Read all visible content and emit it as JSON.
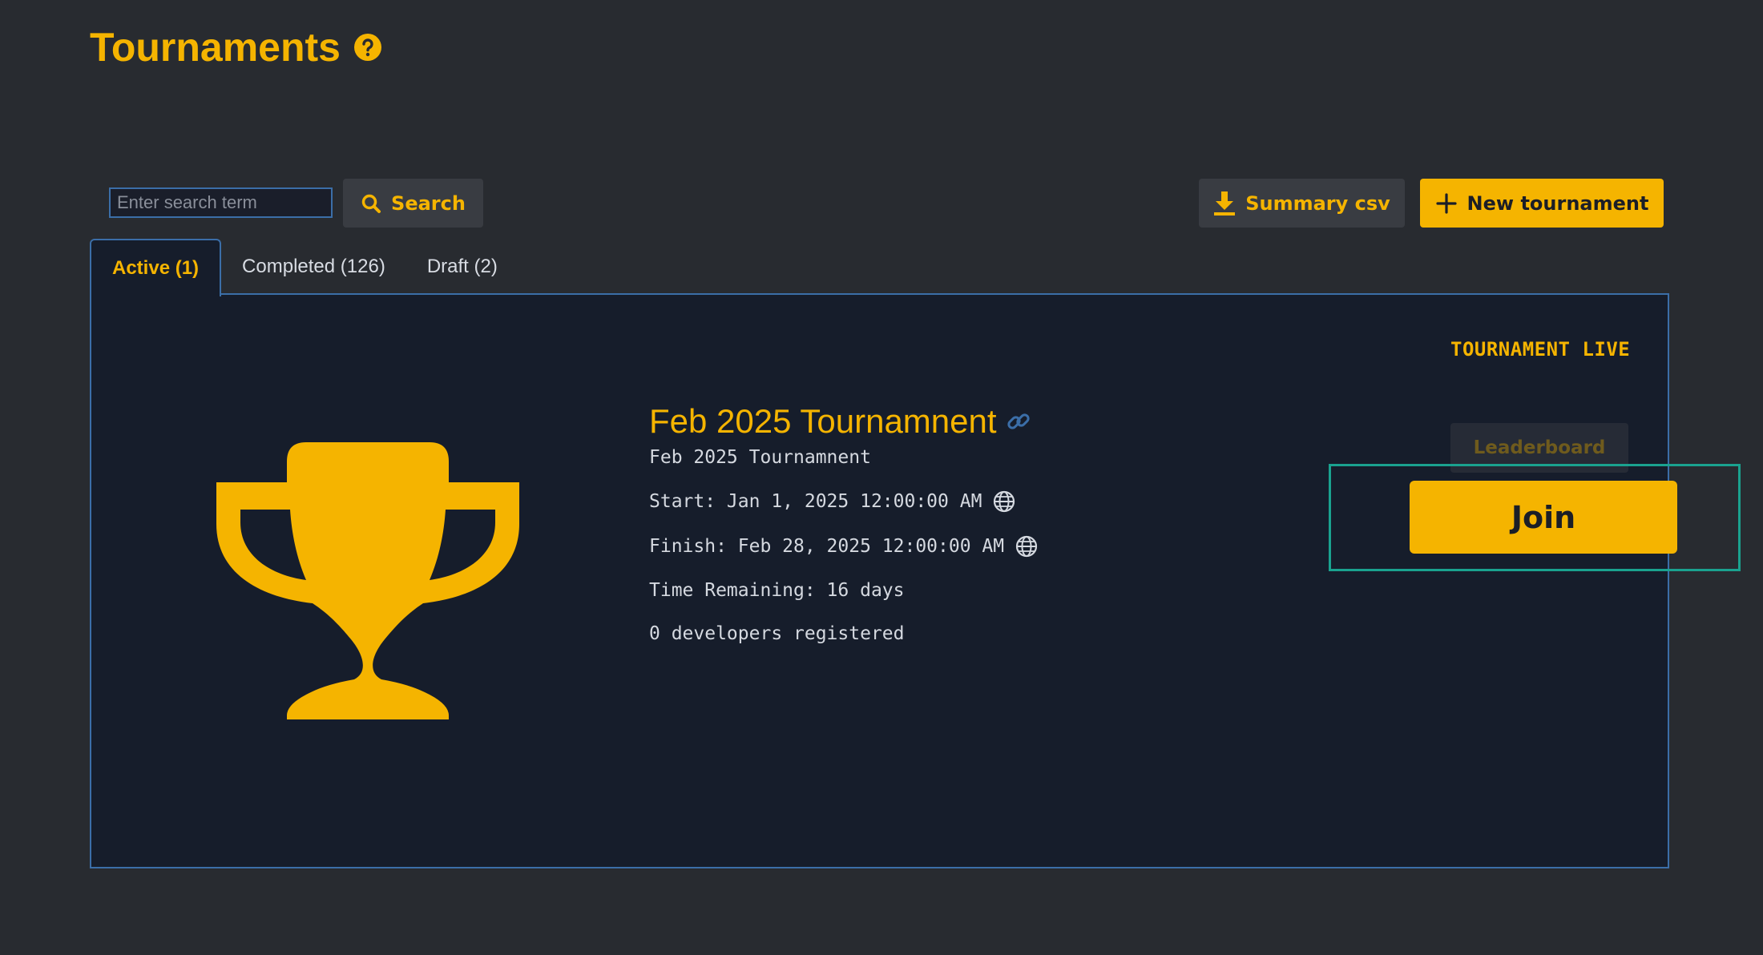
{
  "header": {
    "title": "Tournaments",
    "help_icon": "question-circle-icon"
  },
  "search": {
    "placeholder": "Enter search term",
    "value": "",
    "button_label": "Search",
    "button_icon": "search-icon"
  },
  "actions": {
    "summary_csv_label": "Summary csv",
    "summary_csv_icon": "download-icon",
    "new_tournament_label": "New tournament",
    "new_tournament_icon": "plus-icon"
  },
  "tabs": [
    {
      "label": "Active (1)",
      "active": true
    },
    {
      "label": "Completed (126)",
      "active": false
    },
    {
      "label": "Draft (2)",
      "active": false
    }
  ],
  "tournament": {
    "name": "Feb 2025 Tournamnent",
    "description": "Feb 2025 Tournamnent",
    "start": "Start: Jan 1, 2025 12:00:00 AM",
    "finish": "Finish: Feb 28, 2025 12:00:00 AM",
    "time_remaining": "Time Remaining: 16 days",
    "registered": "0 developers registered",
    "status": "TOURNAMENT LIVE",
    "leaderboard_label": "Leaderboard",
    "join_label": "Join",
    "icon": "trophy-icon"
  },
  "colors": {
    "accent": "#f5b400",
    "background": "#282b30",
    "panel": "#161d2b",
    "border": "#3b6ea8",
    "highlight": "#1aa28f"
  }
}
